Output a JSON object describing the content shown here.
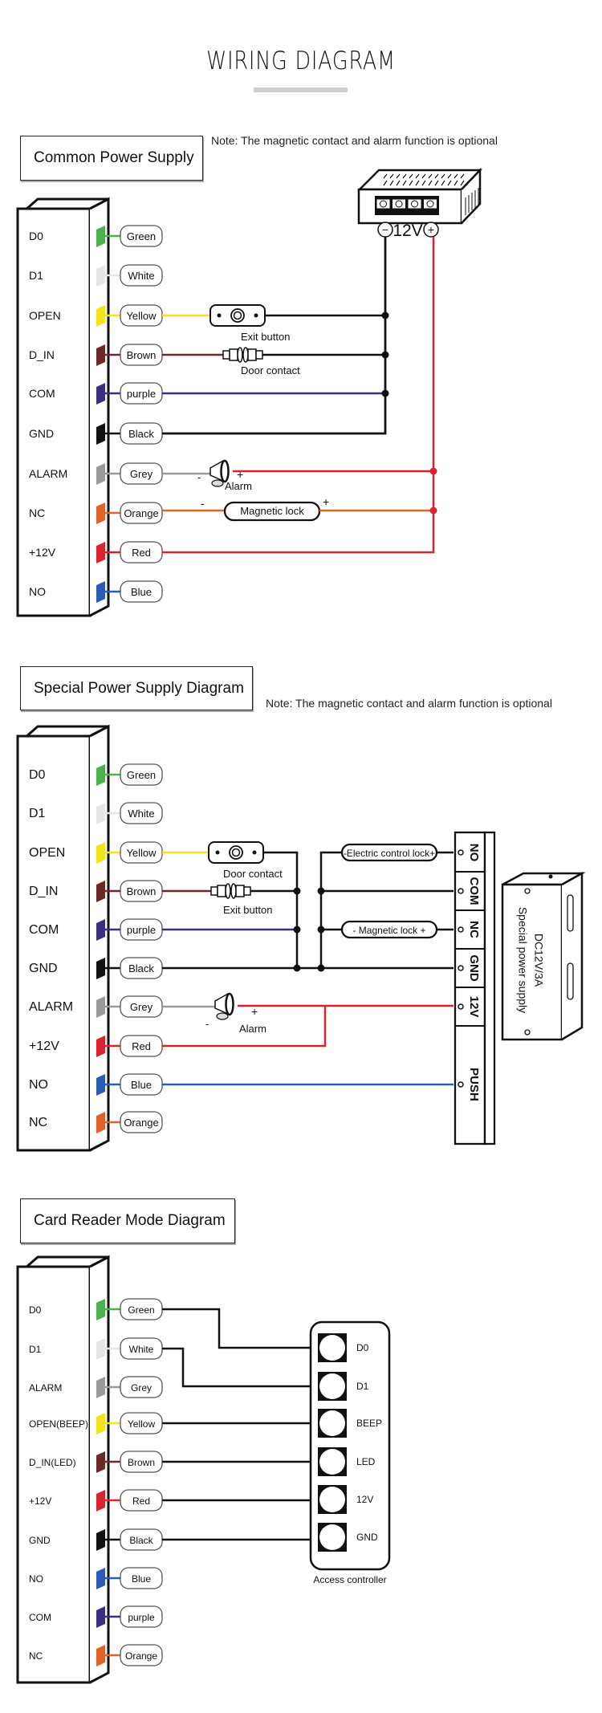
{
  "title": "WIRING DIAGRAM",
  "colors": {
    "Green": "#4caf50",
    "White": "#e6e6e6",
    "Yellow": "#f3e31a",
    "Brown": "#6b2a25",
    "purple": "#3b2f82",
    "Black": "#111111",
    "Grey": "#9a9a9a",
    "Orange": "#e0632a",
    "Red": "#d9242f",
    "Blue": "#2a5bb5"
  },
  "sections": [
    {
      "title": "Common Power Supply",
      "note": "Note: The magnetic contact and alarm function is optional",
      "pins": [
        {
          "label": "D0",
          "wire": "Green"
        },
        {
          "label": "D1",
          "wire": "White"
        },
        {
          "label": "OPEN",
          "wire": "Yellow"
        },
        {
          "label": "D_IN",
          "wire": "Brown"
        },
        {
          "label": "COM",
          "wire": "purple"
        },
        {
          "label": "GND",
          "wire": "Black"
        },
        {
          "label": "ALARM",
          "wire": "Grey"
        },
        {
          "label": "NC",
          "wire": "Orange"
        },
        {
          "label": "+12V",
          "wire": "Red"
        },
        {
          "label": "NO",
          "wire": "Blue"
        }
      ],
      "components": {
        "exit_button": "Exit button",
        "door_contact": "Door contact",
        "alarm": "Alarm",
        "magnetic_lock": "Magnetic lock",
        "psu_voltage": "12V",
        "minus": "-",
        "plus": "+"
      }
    },
    {
      "title": "Special Power Supply Diagram",
      "note": "Note: The magnetic contact and alarm function is optional",
      "pins": [
        {
          "label": "D0",
          "wire": "Green"
        },
        {
          "label": "D1",
          "wire": "White"
        },
        {
          "label": "OPEN",
          "wire": "Yellow"
        },
        {
          "label": "D_IN",
          "wire": "Brown"
        },
        {
          "label": "COM",
          "wire": "purple"
        },
        {
          "label": "GND",
          "wire": "Black"
        },
        {
          "label": "ALARM",
          "wire": "Grey"
        },
        {
          "label": "+12V",
          "wire": "Red"
        },
        {
          "label": "NO",
          "wire": "Blue"
        },
        {
          "label": "NC",
          "wire": "Orange"
        }
      ],
      "components": {
        "door_contact": "Door contact",
        "exit_button": "Exit button",
        "alarm": "Alarm",
        "electric_lock": "-Electric control lock+",
        "magnetic_lock": "- Magnetic lock +",
        "terminals": [
          "NO",
          "COM",
          "NC",
          "GND",
          "12V",
          "PUSH"
        ],
        "psu_line1": "DC12V/3A",
        "psu_line2": "Special power supply",
        "minus": "-",
        "plus": "+"
      }
    },
    {
      "title": "Card Reader Mode Diagram",
      "pins": [
        {
          "label": "D0",
          "wire": "Green"
        },
        {
          "label": "D1",
          "wire": "White"
        },
        {
          "label": "ALARM",
          "wire": "Grey"
        },
        {
          "label": "OPEN(BEEP)",
          "wire": "Yellow"
        },
        {
          "label": "D_IN(LED)",
          "wire": "Brown"
        },
        {
          "label": "+12V",
          "wire": "Red"
        },
        {
          "label": "GND",
          "wire": "Black"
        },
        {
          "label": "NO",
          "wire": "Blue"
        },
        {
          "label": "COM",
          "wire": "purple"
        },
        {
          "label": "NC",
          "wire": "Orange"
        }
      ],
      "components": {
        "controller_terminals": [
          "D0",
          "D1",
          "BEEP",
          "LED",
          "12V",
          "GND"
        ],
        "controller_label": "Access controller"
      }
    }
  ]
}
